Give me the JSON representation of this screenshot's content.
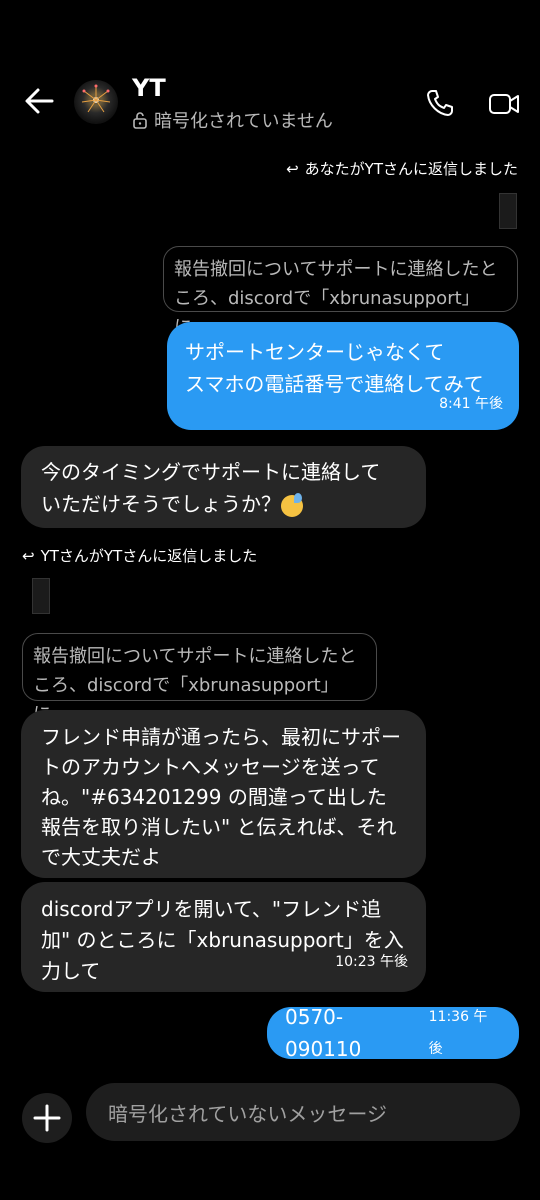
{
  "header": {
    "contact_name": "YT",
    "encryption_status": "暗号化されていません"
  },
  "messages": {
    "reply1_note": "あなたがYTさんに返信しました",
    "reply1_quote": "報告撤回についてサポートに連絡したところ、discordで「xbrunasupport」に...",
    "out1_text_line1": "サポートセンターじゃなくて",
    "out1_text_line2": "スマホの電話番号で連絡してみて",
    "out1_time": "8:41 午後",
    "in1_text_line1": "今のタイミングでサポートに連絡して",
    "in1_text_line2": "いただけそうでしょうか？",
    "reply2_note": "YTさんがYTさんに返信しました",
    "reply2_quote": "報告撤回についてサポートに連絡したところ、discordで「xbrunasupport」に...",
    "in2_text": "フレンド申請が通ったら、最初にサポートのアカウントへメッセージを送ってね。\"#634201299 の間違って出した報告を取り消したい\" と伝えれば、それで大丈夫だよ",
    "in3_text": "discordアプリを開いて、\"フレンド追加\" のところに「xbrunasupport」を入力して",
    "in3_time": "10:23 午後",
    "out2_text": "0570-090110",
    "out2_time": "11:36 午後"
  },
  "composer": {
    "placeholder": "暗号化されていないメッセージ"
  }
}
